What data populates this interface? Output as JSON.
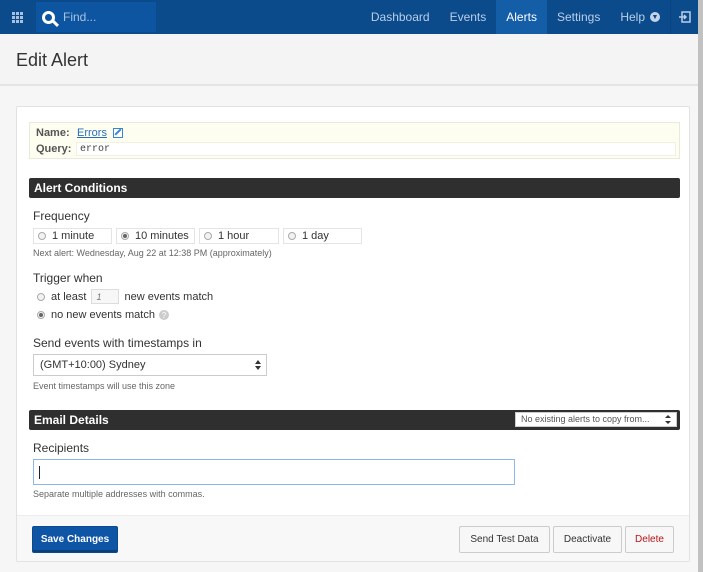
{
  "nav": {
    "search_placeholder": "Find...",
    "links": [
      {
        "label": "Dashboard",
        "active": false
      },
      {
        "label": "Events",
        "active": false
      },
      {
        "label": "Alerts",
        "active": true
      },
      {
        "label": "Settings",
        "active": false
      },
      {
        "label": "Help",
        "active": false
      }
    ],
    "icons": {
      "apps": "grid-icon",
      "search": "search-icon",
      "help": "chevron-down-icon",
      "logout": "logout-icon"
    }
  },
  "page": {
    "title": "Edit Alert"
  },
  "info": {
    "name_label": "Name:",
    "name_value": "Errors",
    "query_label": "Query:",
    "query_value": "error"
  },
  "conditions": {
    "section_title": "Alert Conditions",
    "frequency_label": "Frequency",
    "frequency_options": [
      "1 minute",
      "10 minutes",
      "1 hour",
      "1 day"
    ],
    "frequency_selected": "10 minutes",
    "next_alert": "Next alert: Wednesday, Aug 22 at 12:38 PM (approximately)",
    "trigger_label": "Trigger when",
    "trigger_at_least_prefix": "at least",
    "trigger_count_placeholder": "1",
    "trigger_at_least_suffix": "new events match",
    "trigger_none": "no new events match",
    "trigger_selected": "no new events match",
    "timezone_label": "Send events with timestamps in",
    "timezone_value": "(GMT+10:00) Sydney",
    "timezone_help": "Event timestamps will use this zone"
  },
  "email": {
    "section_title": "Email Details",
    "copy_select_value": "No existing alerts to copy from...",
    "recipients_label": "Recipients",
    "recipients_value": "",
    "recipients_help": "Separate multiple addresses with commas."
  },
  "footer": {
    "save_label": "Save Changes",
    "test_label": "Send Test Data",
    "deactivate_label": "Deactivate",
    "delete_label": "Delete"
  },
  "colors": {
    "nav_bg": "#0b4a8b",
    "nav_active": "#145ea8",
    "section_bar": "#2f2f2f",
    "primary": "#0e55a6",
    "danger_text": "#b5161b",
    "link": "#2a6ebb"
  }
}
